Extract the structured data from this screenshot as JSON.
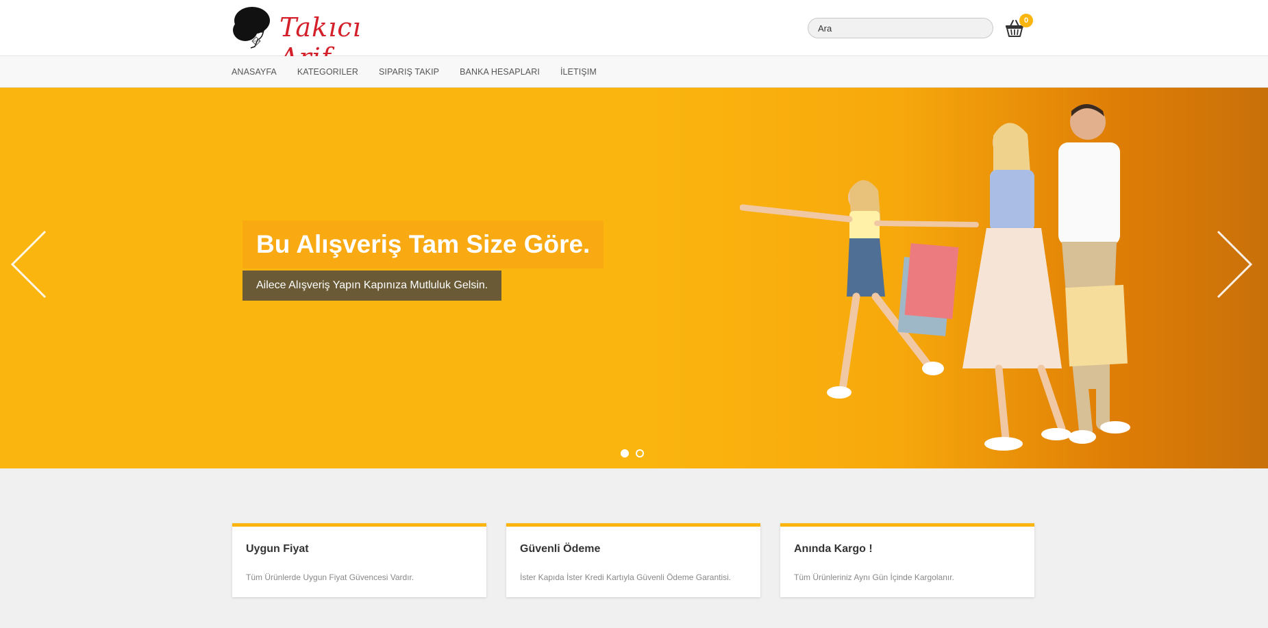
{
  "header": {
    "logo_text": "Takıcı Arif",
    "search_placeholder": "Ara",
    "cart_count": "0"
  },
  "nav": {
    "items": [
      "ANASAYFA",
      "KATEGORILER",
      "SIPARIŞ TAKIP",
      "BANKA HESAPLARI",
      "İLETIŞIM"
    ]
  },
  "hero": {
    "title": "Bu Alışveriş Tam Size Göre.",
    "subtitle": "Ailece Alışveriş Yapın Kapınıza Mutluluk Gelsin.",
    "slide_count": 2,
    "active_slide": 1
  },
  "features": [
    {
      "title": "Uygun Fiyat",
      "text": "Tüm Ürünlerde Uygun Fiyat Güvencesi Vardır."
    },
    {
      "title": "Güvenli Ödeme",
      "text": "İster Kapıda İster Kredi Kartıyla Güvenli Ödeme Garantisi."
    },
    {
      "title": "Anında Kargo !",
      "text": "Tüm Ürünleriniz Aynı Gün İçinde Kargolanır."
    }
  ],
  "colors": {
    "accent": "#fbb50f",
    "brand_red": "#d4202a",
    "subtitle_bg": "#6b5a36"
  },
  "icons": {
    "cart": "basket-icon",
    "prev": "chevron-left-icon",
    "next": "chevron-right-icon"
  }
}
